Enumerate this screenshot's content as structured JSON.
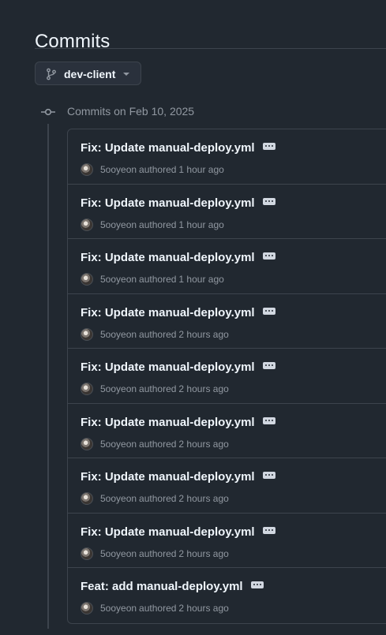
{
  "page": {
    "title": "Commits"
  },
  "branch_selector": {
    "icon": "git-branch-icon",
    "label": "dev-client",
    "caret_icon": "triangle-down-icon"
  },
  "commit_group": {
    "icon": "git-commit-icon",
    "heading": "Commits on Feb 10, 2025",
    "commits": [
      {
        "title": "Fix: Update manual-deploy.yml",
        "author": "5ooyeon",
        "authored": "authored",
        "time": "1 hour ago"
      },
      {
        "title": "Fix: Update manual-deploy.yml",
        "author": "5ooyeon",
        "authored": "authored",
        "time": "1 hour ago"
      },
      {
        "title": "Fix: Update manual-deploy.yml",
        "author": "5ooyeon",
        "authored": "authored",
        "time": "1 hour ago"
      },
      {
        "title": "Fix: Update manual-deploy.yml",
        "author": "5ooyeon",
        "authored": "authored",
        "time": "2 hours ago"
      },
      {
        "title": "Fix: Update manual-deploy.yml",
        "author": "5ooyeon",
        "authored": "authored",
        "time": "2 hours ago"
      },
      {
        "title": "Fix: Update manual-deploy.yml",
        "author": "5ooyeon",
        "authored": "authored",
        "time": "2 hours ago"
      },
      {
        "title": "Fix: Update manual-deploy.yml",
        "author": "5ooyeon",
        "authored": "authored",
        "time": "2 hours ago"
      },
      {
        "title": "Fix: Update manual-deploy.yml",
        "author": "5ooyeon",
        "authored": "authored",
        "time": "2 hours ago"
      },
      {
        "title": "Feat: add manual-deploy.yml",
        "author": "5ooyeon",
        "authored": "authored",
        "time": "2 hours ago"
      }
    ]
  },
  "colors": {
    "background": "#212830",
    "border": "#3d444d",
    "text_primary": "#f0f6fc",
    "text_muted": "#9198a1"
  }
}
